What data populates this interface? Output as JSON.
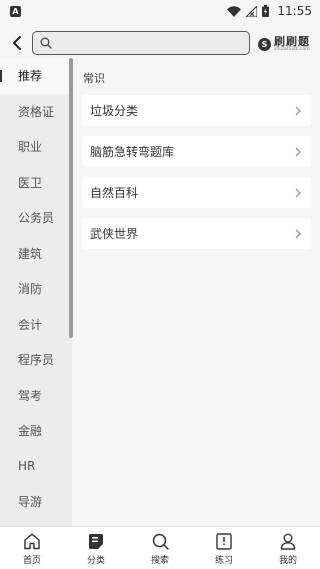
{
  "status_bar": {
    "app_badge": "A",
    "time": "11:55"
  },
  "header": {
    "search_placeholder": "",
    "brand_logo_letter": "S",
    "brand_name": "刷刷题",
    "brand_url": "shuashuati.com"
  },
  "sidebar": {
    "items": [
      {
        "label": "推荐",
        "active": true
      },
      {
        "label": "资格证"
      },
      {
        "label": "职业"
      },
      {
        "label": "医卫"
      },
      {
        "label": "公务员"
      },
      {
        "label": "建筑"
      },
      {
        "label": "消防"
      },
      {
        "label": "会计"
      },
      {
        "label": "程序员"
      },
      {
        "label": "驾考"
      },
      {
        "label": "金融"
      },
      {
        "label": "HR"
      },
      {
        "label": "导游"
      }
    ]
  },
  "main": {
    "section_title": "常识",
    "cards": [
      {
        "label": "垃圾分类"
      },
      {
        "label": "脑筋急转弯题库"
      },
      {
        "label": "自然百科"
      },
      {
        "label": "武侠世界"
      }
    ]
  },
  "bottom_nav": {
    "items": [
      {
        "label": "首页",
        "icon": "home-icon"
      },
      {
        "label": "分类",
        "icon": "category-icon",
        "active": true
      },
      {
        "label": "搜索",
        "icon": "search-icon"
      },
      {
        "label": "练习",
        "icon": "practice-book-icon"
      },
      {
        "label": "我的",
        "icon": "profile-icon"
      }
    ]
  }
}
